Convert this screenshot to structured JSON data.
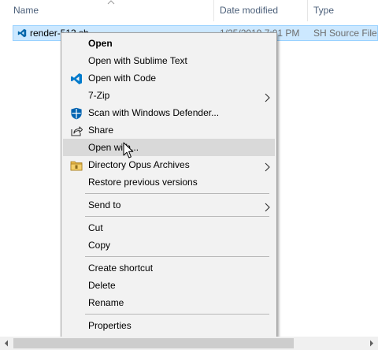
{
  "columns": {
    "name": "Name",
    "date_modified": "Date modified",
    "type": "Type"
  },
  "file": {
    "name": "render-513.sh",
    "date": "1/25/2019 7:01 PM",
    "type": "SH Source File"
  },
  "menu": {
    "items": [
      {
        "label": "Open",
        "bold": true
      },
      {
        "label": "Open with Sublime Text"
      },
      {
        "label": "Open with Code",
        "icon": "vscode-icon"
      },
      {
        "label": "7-Zip",
        "submenu": true
      },
      {
        "label": "Scan with Windows Defender...",
        "icon": "windows-defender-icon"
      },
      {
        "label": "Share",
        "icon": "share-icon"
      },
      {
        "label": "Open with...",
        "hovered": true
      },
      {
        "label": "Directory Opus Archives",
        "icon": "directory-opus-icon",
        "submenu": true
      },
      {
        "label": "Restore previous versions"
      },
      {
        "label": "Send to",
        "submenu": true
      },
      {
        "label": "Cut"
      },
      {
        "label": "Copy"
      },
      {
        "label": "Create shortcut"
      },
      {
        "label": "Delete"
      },
      {
        "label": "Rename"
      },
      {
        "label": "Properties"
      }
    ]
  },
  "colors": {
    "selection": "#cce8ff",
    "hover": "#d9d9d9",
    "menu_bg": "#f2f2f2",
    "vscode_blue": "#007acc",
    "defender_blue": "#0063b1"
  }
}
